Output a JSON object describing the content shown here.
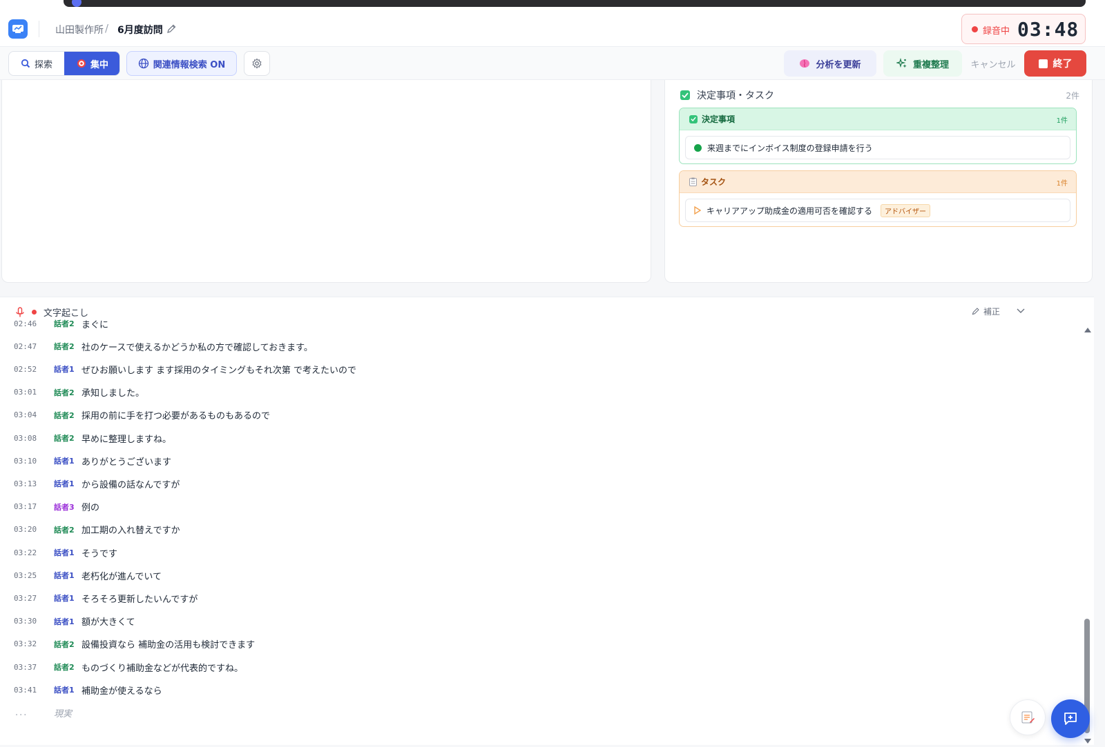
{
  "header": {
    "breadcrumb_parent": "山田製作所",
    "breadcrumb_separator": "/",
    "title": "6月度訪問",
    "recording_label": "録音中",
    "recording_time": "03:48"
  },
  "toolbar": {
    "mode_explore": "探索",
    "mode_focus": "集中",
    "related_search": "関連情報検索 ON",
    "refresh_analysis": "分析を更新",
    "dedupe": "重複整理",
    "cancel": "キャンセル",
    "end": "終了"
  },
  "decisions_panel": {
    "title": "決定事項・タスク",
    "count": "2件",
    "decisions": {
      "title": "決定事項",
      "count": "1件",
      "items": [
        "来週までにインボイス制度の登録申請を行う"
      ]
    },
    "tasks": {
      "title": "タスク",
      "count": "1件",
      "items": [
        {
          "text": "キャリアアップ助成金の適用可否を確認する",
          "assignee": "アドバイザー"
        }
      ]
    }
  },
  "transcript": {
    "title": "文字起こし",
    "correct": "補正",
    "rows": [
      {
        "time": "02:46",
        "speaker": "話者2",
        "text": "まぐに"
      },
      {
        "time": "02:47",
        "speaker": "話者2",
        "text": "社のケースで使えるかどうか私の方で確認しておきます。"
      },
      {
        "time": "02:52",
        "speaker": "話者1",
        "text": "ぜひお願いします ます採用のタイミングもそれ次第 で考えたいので"
      },
      {
        "time": "03:01",
        "speaker": "話者2",
        "text": "承知しました。"
      },
      {
        "time": "03:04",
        "speaker": "話者2",
        "text": "採用の前に手を打つ必要があるものもあるので"
      },
      {
        "time": "03:08",
        "speaker": "話者2",
        "text": "早めに整理しますね。"
      },
      {
        "time": "03:10",
        "speaker": "話者1",
        "text": "ありがとうございます"
      },
      {
        "time": "03:13",
        "speaker": "話者1",
        "text": "から設備の話なんですが"
      },
      {
        "time": "03:17",
        "speaker": "話者3",
        "text": "例の"
      },
      {
        "time": "03:20",
        "speaker": "話者2",
        "text": "加工期の入れ替えですか"
      },
      {
        "time": "03:22",
        "speaker": "話者1",
        "text": "そうです"
      },
      {
        "time": "03:25",
        "speaker": "話者1",
        "text": "老朽化が進んでいて"
      },
      {
        "time": "03:27",
        "speaker": "話者1",
        "text": "そろそろ更新したいんですが"
      },
      {
        "time": "03:30",
        "speaker": "話者1",
        "text": "額が大きくて"
      },
      {
        "time": "03:32",
        "speaker": "話者2",
        "text": "設備投資なら 補助金の活用も検討できます"
      },
      {
        "time": "03:37",
        "speaker": "話者2",
        "text": "ものづくり補助金などが代表的ですね。"
      },
      {
        "time": "03:41",
        "speaker": "話者1",
        "text": "補助金が使えるなら"
      }
    ],
    "pending_dots": "...",
    "interim_text": "現実"
  },
  "colors": {
    "accent": "#3b5bdb",
    "recording": "#ef4444",
    "end_button": "#e5483f",
    "speaker1": "#3b4fc4",
    "speaker2": "#1e8a55",
    "speaker3": "#9b30d9"
  }
}
